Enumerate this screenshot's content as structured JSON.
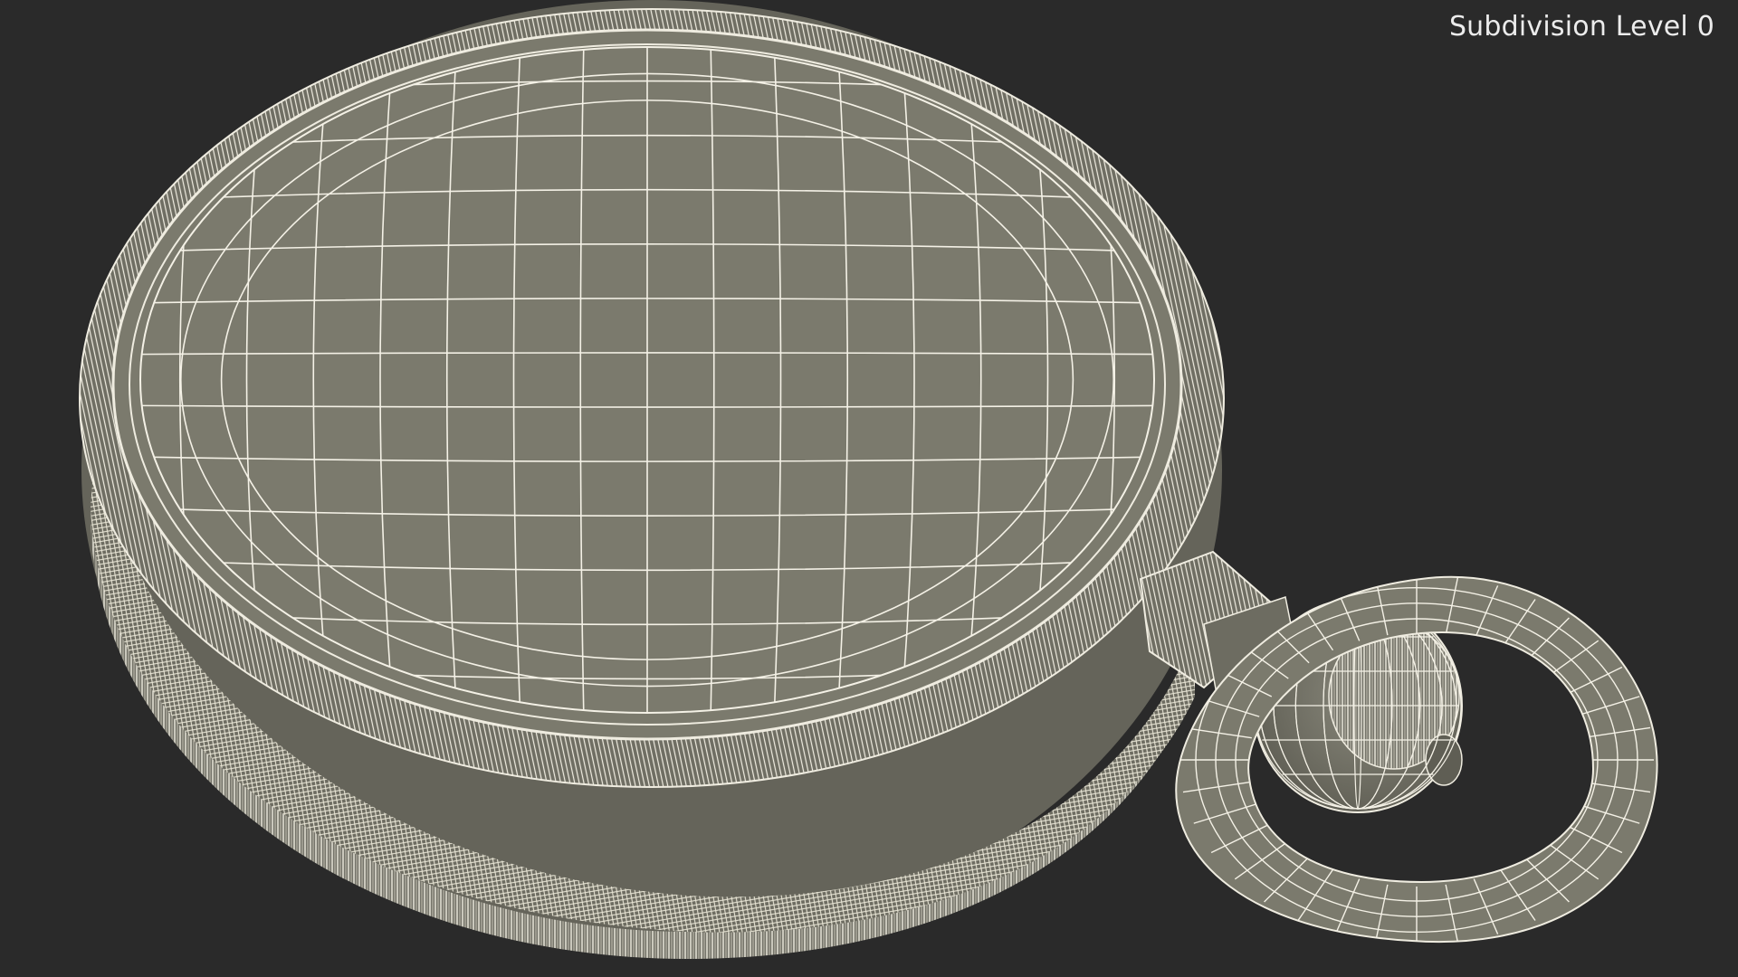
{
  "overlay": {
    "subdivision_label": "Subdivision Level 0"
  },
  "scene": {
    "subject": "pocket-watch-wireframe",
    "background_color": "#2a2a2a",
    "surface_color": "#7b7a6d",
    "wire_color": "#f4f1e6"
  }
}
